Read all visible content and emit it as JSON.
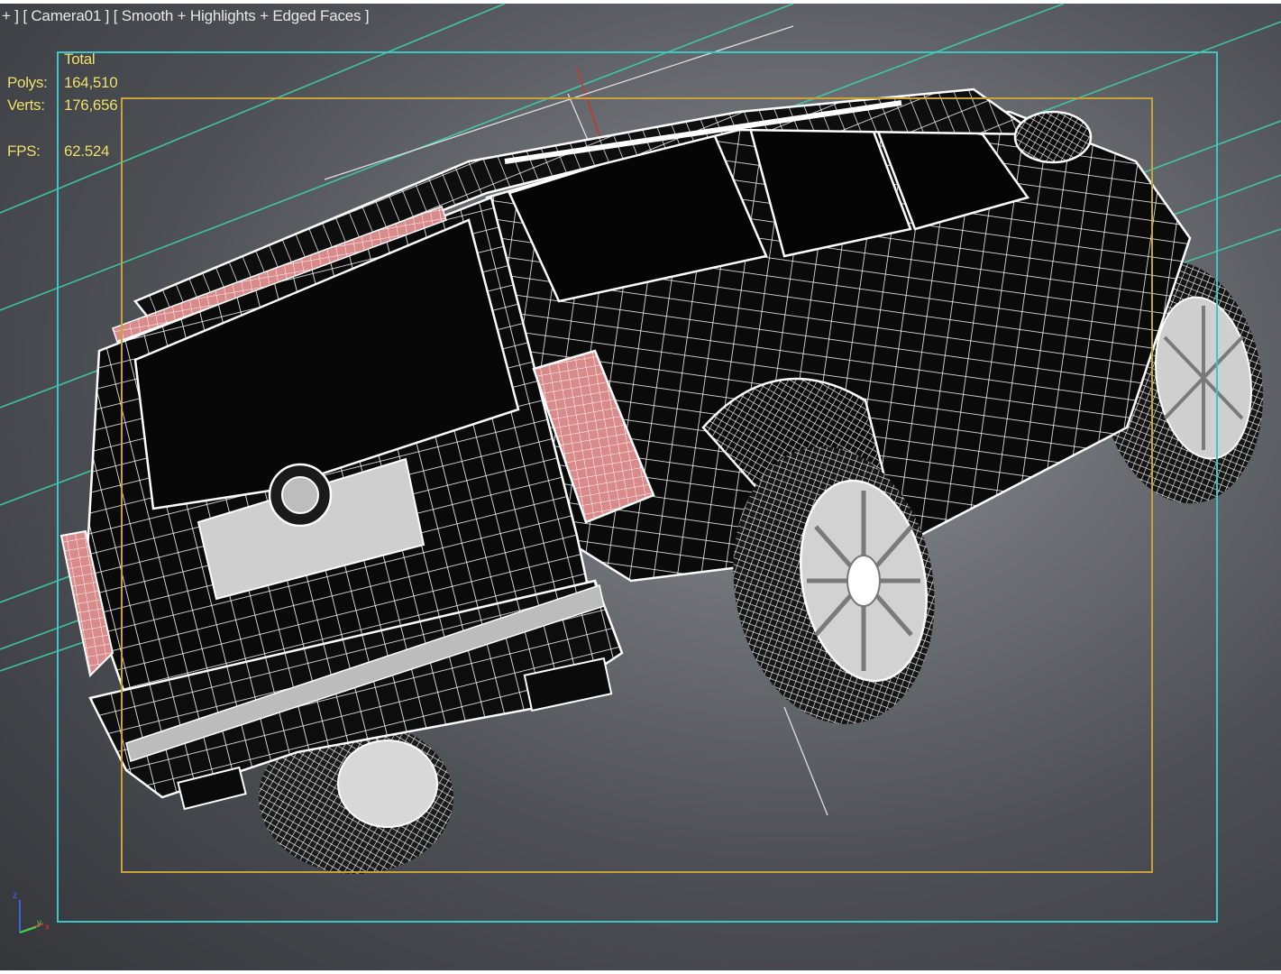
{
  "viewport": {
    "label_prefix": "+ ]",
    "camera_label": "[ Camera01 ]",
    "shading_label": "[ Smooth + Highlights + Edged Faces ]"
  },
  "stats": {
    "total_header": "Total",
    "polys_label": "Polys:",
    "polys_value": "164,510",
    "verts_label": "Verts:",
    "verts_value": "176,656",
    "fps_label": "FPS:",
    "fps_value": "62.524"
  },
  "gizmo": {
    "z_label": "z",
    "y_label": "y",
    "x_label": "x"
  },
  "colors": {
    "safe_frame_outer": "#3cc6c8",
    "safe_frame_inner": "#c9a23a",
    "stats_text": "#f0e27a",
    "wire": "#ffffff",
    "light_red": "#d98a8a",
    "guide_lines": "#3fd0a8"
  }
}
